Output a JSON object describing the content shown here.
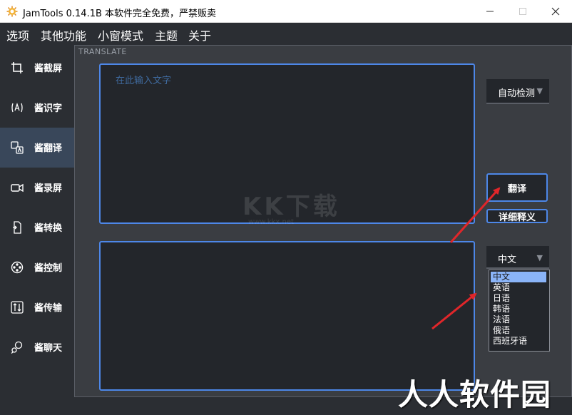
{
  "window": {
    "title": "JamTools 0.14.1B 本软件完全免费，严禁贩卖",
    "minimize_glyph": "—",
    "maximize_glyph": "☐",
    "close_glyph": "✕"
  },
  "menu": {
    "items": [
      {
        "label": "选项"
      },
      {
        "label": "其他功能"
      },
      {
        "label": "小窗模式"
      },
      {
        "label": "主题"
      },
      {
        "label": "关于"
      }
    ]
  },
  "sidebar": {
    "items": [
      {
        "label": "酱截屏",
        "icon": "crop-icon",
        "active": false
      },
      {
        "label": "酱识字",
        "icon": "ocr-icon",
        "active": false
      },
      {
        "label": "酱翻译",
        "icon": "translate-icon",
        "active": true
      },
      {
        "label": "酱录屏",
        "icon": "camera-icon",
        "active": false
      },
      {
        "label": "酱转换",
        "icon": "convert-icon",
        "active": false
      },
      {
        "label": "酱控制",
        "icon": "control-icon",
        "active": false
      },
      {
        "label": "酱传输",
        "icon": "transfer-icon",
        "active": false
      },
      {
        "label": "酱聊天",
        "icon": "chat-icon",
        "active": false
      }
    ]
  },
  "translate": {
    "panel_title": "TRANSLATE",
    "input_placeholder": "在此输入文字",
    "source_language": "自动检测",
    "translate_button": "翻译",
    "detail_button": "详细释义",
    "target_language": "中文",
    "language_options": [
      "中文",
      "英语",
      "日语",
      "韩语",
      "法语",
      "俄语",
      "西班牙语"
    ],
    "selected_index": 0
  },
  "watermarks": {
    "center_main": "KK下载",
    "center_sub": "www.kkx.net",
    "corner": "人人软件园"
  },
  "colors": {
    "accent": "#4d87e8",
    "annotation_arrow": "#e0262a",
    "background": "#2b2e33"
  }
}
